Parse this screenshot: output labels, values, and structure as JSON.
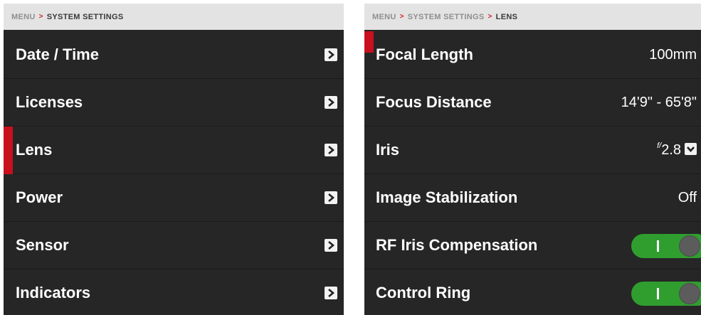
{
  "left_panel": {
    "breadcrumb": {
      "root": "MENU",
      "separator": ">",
      "current": "SYSTEM SETTINGS"
    },
    "items": [
      {
        "label": "Date / Time"
      },
      {
        "label": "Licenses"
      },
      {
        "label": "Lens"
      },
      {
        "label": "Power"
      },
      {
        "label": "Sensor"
      },
      {
        "label": "Indicators"
      }
    ],
    "selected_index": 2,
    "item_icon": "chevron-right-icon"
  },
  "right_panel": {
    "breadcrumb": {
      "root": "MENU",
      "separator": ">",
      "middle": "SYSTEM SETTINGS",
      "current": "LENS"
    },
    "items": [
      {
        "label": "Focal Length",
        "value": "100mm"
      },
      {
        "label": "Focus Distance",
        "value": "14'9\" - 65'8\""
      },
      {
        "label": "Iris",
        "f_prefix": "f/",
        "value": "2.8"
      },
      {
        "label": "Image Stabilization",
        "value": "Off"
      },
      {
        "label": "RF Iris Compensation",
        "toggle_on": true
      },
      {
        "label": "Control Ring",
        "toggle_on": true
      }
    ],
    "selected_index": 0,
    "iris_dropdown_icon": "chevron-down-icon"
  },
  "colors": {
    "panel_bg": "#262626",
    "breadcrumb_bg": "#e3e3e3",
    "accent_red": "#c8101e",
    "toggle_on_green": "#2f9e2f",
    "text": "#ffffff"
  }
}
